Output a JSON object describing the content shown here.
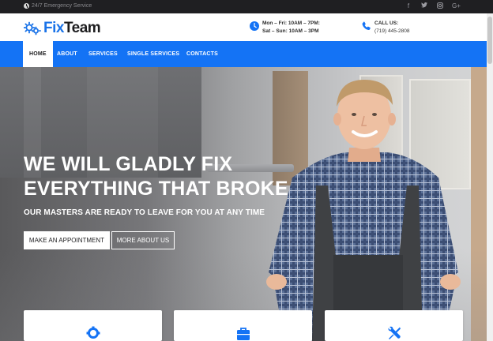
{
  "topbar": {
    "emergency_text": "24/7 Emergency Service",
    "social": [
      {
        "name": "facebook-icon",
        "glyph": "f"
      },
      {
        "name": "twitter-icon",
        "glyph": "t"
      },
      {
        "name": "instagram-icon",
        "glyph": "◎"
      },
      {
        "name": "google-plus-icon",
        "glyph": "G+"
      }
    ]
  },
  "header": {
    "logo_part1": "Fix",
    "logo_part2": "Team",
    "hours_line1": "Mon – Fri: 10AM – 7PM:",
    "hours_line2": "Sat – Sun: 10AM – 3PM",
    "call_label": "CALL US:",
    "phone": "(719) 445-2808"
  },
  "nav": {
    "items": [
      "HOME",
      "ABOUT",
      "SERVICES",
      "SINGLE SERVICES",
      "CONTACTS"
    ]
  },
  "hero": {
    "headline_line1": "WE WILL GLADLY FIX",
    "headline_line2": "EVERYTHING THAT BROKE",
    "subheadline": "OUR MASTERS ARE READY TO LEAVE FOR YOU AT ANY TIME",
    "primary_button": "MAKE AN APPOINTMENT",
    "secondary_button": "MORE ABOUT US"
  },
  "colors": {
    "accent": "#1473f5",
    "topbar_bg": "#1f1f22",
    "text_dark": "#1d1d1f"
  },
  "cards": [
    {
      "icon": "gear-icon"
    },
    {
      "icon": "toolbox-icon"
    },
    {
      "icon": "wrench-screwdriver-icon"
    }
  ]
}
